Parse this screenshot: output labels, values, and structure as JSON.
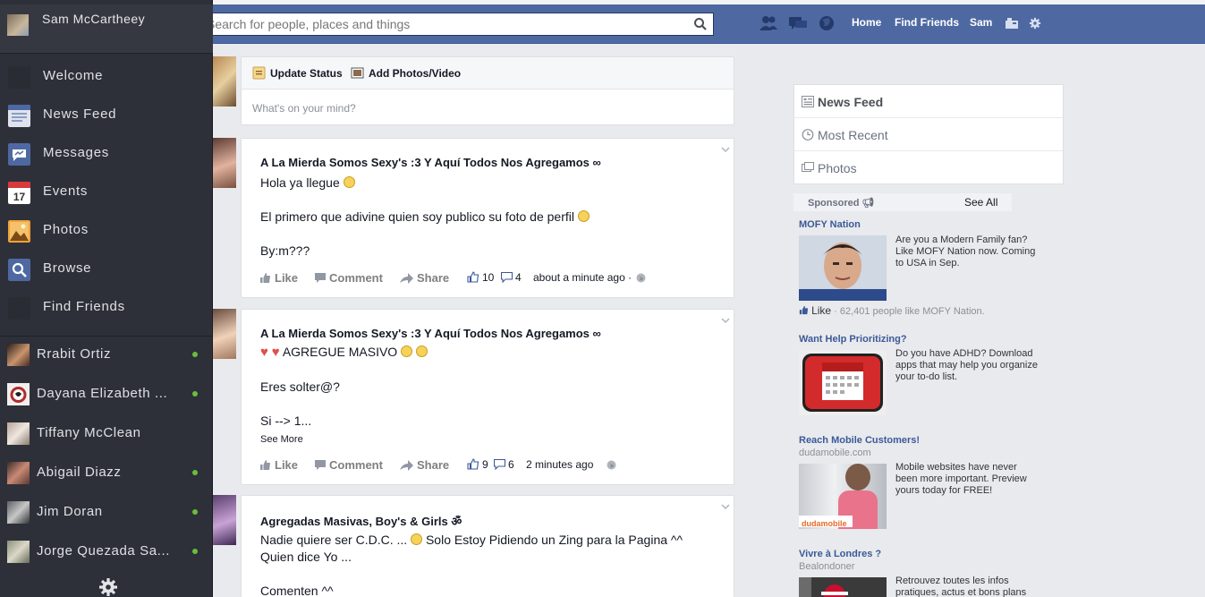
{
  "topbar": {
    "search_placeholder": "Search for people, places and things",
    "nav_home": "Home",
    "nav_find_friends": "Find Friends",
    "nav_user": "Sam",
    "bar_color": "#4e69a2"
  },
  "sidebar": {
    "profile_name": "Sam McCartheey",
    "items": [
      {
        "label": "Welcome",
        "icon": "welcome-icon"
      },
      {
        "label": "News Feed",
        "icon": "news-feed-icon"
      },
      {
        "label": "Messages",
        "icon": "messages-icon"
      },
      {
        "label": "Events",
        "icon": "calendar-icon",
        "badge": "17"
      },
      {
        "label": "Photos",
        "icon": "photos-icon"
      },
      {
        "label": "Browse",
        "icon": "search-icon"
      },
      {
        "label": "Find Friends",
        "icon": "find-friends-icon"
      }
    ],
    "friends": [
      {
        "name": "Rrabit Ortiz",
        "online": true
      },
      {
        "name": "Dayana Elizabeth ...",
        "online": true
      },
      {
        "name": "Tiffany McClean",
        "online": false
      },
      {
        "name": "Abigail Diazz",
        "online": true
      },
      {
        "name": "Jim Doran",
        "online": true
      },
      {
        "name": "Jorge Quezada Sa...",
        "online": true
      }
    ]
  },
  "composer": {
    "update_status": "Update Status",
    "add_photos": "Add Photos/Video",
    "placeholder": "What's on your mind?"
  },
  "posts": [
    {
      "group": "A La Mierda Somos Sexy's :3 Y Aquí Todos Nos Agregamos ∞",
      "line1": "Hola ya llegue",
      "line2": "El primero que adivine quien soy publico su foto de perfil",
      "line3": "By:m???",
      "like": "Like",
      "comment": "Comment",
      "share": "Share",
      "likes": "10",
      "comments": "4",
      "time": "about a minute ago ·"
    },
    {
      "group": "A La Mierda Somos Sexy's :3 Y Aquí Todos Nos Agregamos ∞",
      "line1": "AGREGUE MASIVO",
      "line2": "Eres solter@?",
      "line3": "Si --> 1...",
      "see_more": "See More",
      "like": "Like",
      "comment": "Comment",
      "share": "Share",
      "likes": "9",
      "comments": "6",
      "time": "2 minutes ago"
    },
    {
      "group": "Agregadas Masivas, Boy's & Girls ॐ",
      "line1": "Nadie quiere ser C.D.C. ...",
      "line1b": "Solo Estoy Pidiendo un Zing para la Pagina ^^",
      "line2": "Quien dice Yo ...",
      "line3": "Comenten ^^"
    }
  ],
  "right_nav": {
    "items": [
      {
        "label": "News Feed",
        "icon": "news-feed-icon",
        "active": true
      },
      {
        "label": "Most Recent",
        "icon": "clock-icon",
        "active": false
      },
      {
        "label": "Photos",
        "icon": "photos-icon",
        "active": false
      }
    ]
  },
  "sponsored": {
    "label": "Sponsored",
    "see_all": "See All",
    "ads": [
      {
        "title": "MOFY Nation",
        "text": "Are you a Modern Family fan? Like MOFY Nation now. Coming to USA in Sep.",
        "like_label": "Like",
        "like_count": "· 62,401 people like MOFY Nation."
      },
      {
        "title": "Want Help Prioritizing?",
        "text": "Do you have ADHD? Download apps that may help you organize your to-do list."
      },
      {
        "title": "Reach Mobile Customers!",
        "domain": "dudamobile.com",
        "text": "Mobile websites have never been more important. Preview yours today for FREE!",
        "img_brand": "dudamobile"
      },
      {
        "title": "Vivre à Londres ?",
        "domain": "Bealondoner",
        "text": "Retrouvez toutes les infos pratiques, actus et bons plans"
      }
    ]
  }
}
